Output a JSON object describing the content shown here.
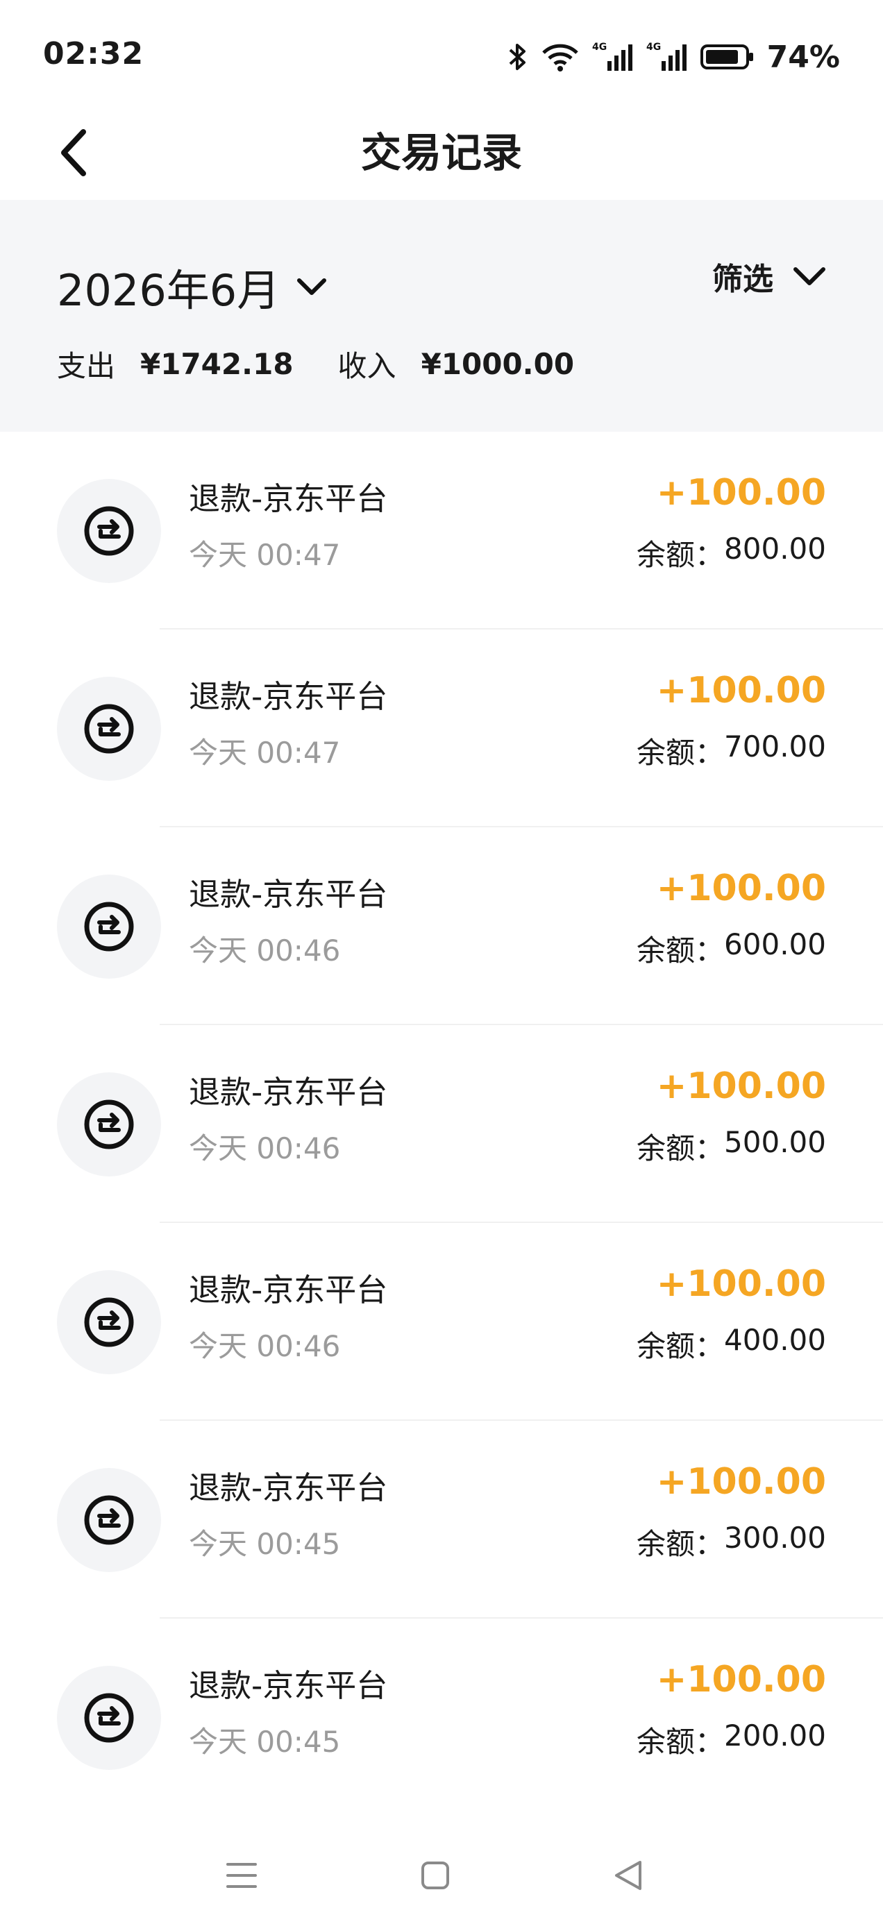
{
  "status_bar": {
    "time": "02:32",
    "battery": "74%",
    "icons": [
      "bluetooth-icon",
      "wifi-icon",
      "signal-4g-icon",
      "signal-4g-icon",
      "battery-icon"
    ]
  },
  "header": {
    "title": "交易记录",
    "back_icon": "chevron-left-icon"
  },
  "summary": {
    "month": "2026年6月",
    "filter_label": "筛选",
    "expense_label": "支出",
    "expense_value": "¥1742.18",
    "income_label": "收入",
    "income_value": "¥1000.00"
  },
  "transactions": [
    {
      "title": "退款-京东平台",
      "time": "今天 00:47",
      "amount": "+100.00",
      "balance_label": "余额：",
      "balance": "800.00",
      "icon": "refund-icon"
    },
    {
      "title": "退款-京东平台",
      "time": "今天 00:47",
      "amount": "+100.00",
      "balance_label": "余额：",
      "balance": "700.00",
      "icon": "refund-icon"
    },
    {
      "title": "退款-京东平台",
      "time": "今天 00:46",
      "amount": "+100.00",
      "balance_label": "余额：",
      "balance": "600.00",
      "icon": "refund-icon"
    },
    {
      "title": "退款-京东平台",
      "time": "今天 00:46",
      "amount": "+100.00",
      "balance_label": "余额：",
      "balance": "500.00",
      "icon": "refund-icon"
    },
    {
      "title": "退款-京东平台",
      "time": "今天 00:46",
      "amount": "+100.00",
      "balance_label": "余额：",
      "balance": "400.00",
      "icon": "refund-icon"
    },
    {
      "title": "退款-京东平台",
      "time": "今天 00:45",
      "amount": "+100.00",
      "balance_label": "余额：",
      "balance": "300.00",
      "icon": "refund-icon"
    },
    {
      "title": "退款-京东平台",
      "time": "今天 00:45",
      "amount": "+100.00",
      "balance_label": "余额：",
      "balance": "200.00",
      "icon": "refund-icon"
    }
  ],
  "colors": {
    "accent_income": "#f5a623",
    "summary_bg": "#f5f6f8",
    "muted_text": "#9b9b9b"
  },
  "nav_bar": {
    "icons": [
      "menu-icon",
      "home-icon",
      "back-triangle-icon"
    ]
  }
}
